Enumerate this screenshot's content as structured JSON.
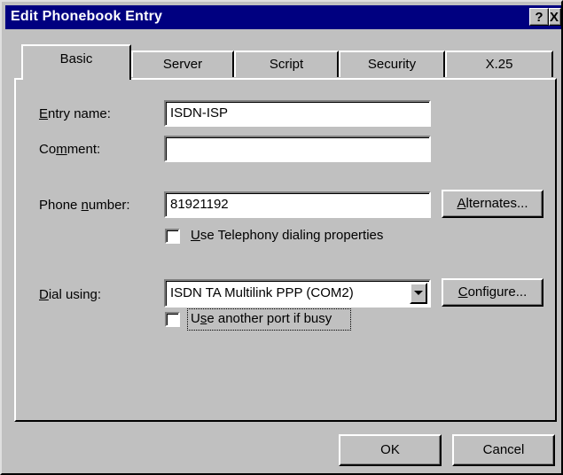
{
  "window": {
    "title": "Edit Phonebook Entry",
    "help_glyph": "?",
    "close_glyph": "X"
  },
  "tabs": [
    {
      "label": "Basic",
      "active": true
    },
    {
      "label": "Server",
      "active": false
    },
    {
      "label": "Script",
      "active": false
    },
    {
      "label": "Security",
      "active": false
    },
    {
      "label": "X.25",
      "active": false
    }
  ],
  "form": {
    "entry_name": {
      "label_accel": "E",
      "label_rest": "ntry name:",
      "value": "ISDN-ISP"
    },
    "comment": {
      "label_pre": "Co",
      "label_accel": "m",
      "label_rest": "ment:",
      "value": ""
    },
    "phone_number": {
      "label_pre": "Phone ",
      "label_accel": "n",
      "label_rest": "umber:",
      "value": "81921192"
    },
    "alternates_button": {
      "accel": "A",
      "rest": "lternates..."
    },
    "telephony_checkbox": {
      "accel": "U",
      "rest": "se Telephony dialing properties",
      "checked": false
    },
    "dial_using": {
      "label_accel": "D",
      "label_rest": "ial using:",
      "value": "ISDN TA Multilink PPP (COM2)"
    },
    "configure_button": {
      "accel": "C",
      "rest": "onfigure..."
    },
    "another_port_checkbox": {
      "pre": "U",
      "accel": "s",
      "rest": "e another port if busy",
      "checked": false
    }
  },
  "footer": {
    "ok_label": "OK",
    "cancel_label": "Cancel"
  },
  "colors": {
    "titlebar": "#000080",
    "face": "#c0c0c0"
  }
}
